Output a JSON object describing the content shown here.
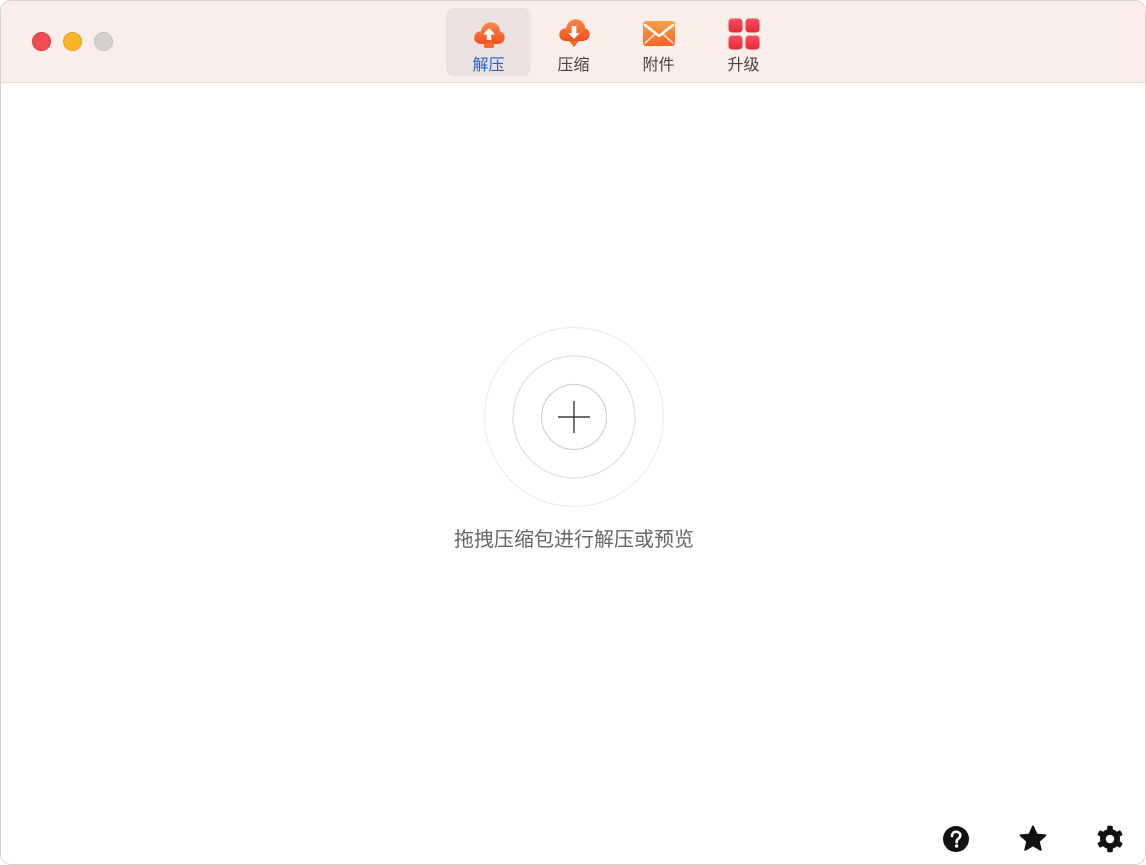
{
  "window": {
    "traffic_lights": [
      "close",
      "minimize",
      "zoom"
    ]
  },
  "toolbar": {
    "items": [
      {
        "label": "解压",
        "icon": "cloud-upload-icon",
        "active": true
      },
      {
        "label": "压缩",
        "icon": "cloud-download-icon",
        "active": false
      },
      {
        "label": "附件",
        "icon": "mail-icon",
        "active": false
      },
      {
        "label": "升级",
        "icon": "grid-icon",
        "active": false
      }
    ]
  },
  "main": {
    "drop_hint": "拖拽压缩包进行解压或预览",
    "drop_icon": "plus-icon"
  },
  "footer": {
    "buttons": [
      {
        "icon": "help-icon"
      },
      {
        "icon": "star-icon"
      },
      {
        "icon": "gear-icon"
      }
    ]
  },
  "colors": {
    "titlebar_bg": "#f9eeea",
    "active_tab_bg": "#ebe2df",
    "active_label": "#1f5fd6",
    "icon_orange": "#f4652c",
    "icon_red": "#ee3545"
  }
}
